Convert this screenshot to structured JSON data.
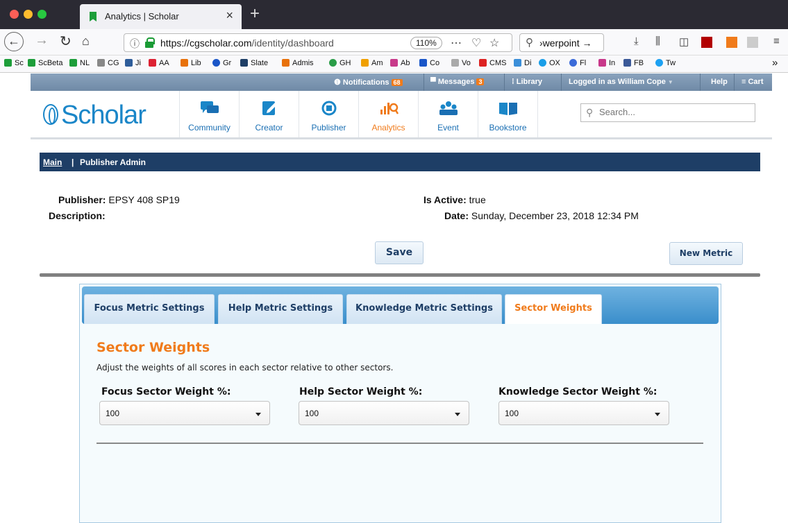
{
  "browser": {
    "tab_title": "Analytics | Scholar",
    "tab_close": "×",
    "new_tab": "+",
    "url_domain": "https://cgscholar.com",
    "url_path": "/identity/dashboard",
    "zoom": "110%",
    "search_text": "›werpoint →",
    "bookmarks": [
      "Sc",
      "ScBeta",
      "NL",
      "CG",
      "Ji",
      "AA",
      "Lib",
      "Gr",
      "Slate",
      "Admis",
      "GH",
      "Am",
      "Ab",
      "Co",
      "Vo",
      "CMS",
      "Di",
      "OX",
      "Fl",
      "In",
      "FB",
      "Tw"
    ],
    "overflow": "»"
  },
  "topstrip": {
    "notifications": "Notifications",
    "notifications_count": "68",
    "messages": "Messages",
    "messages_count": "3",
    "library": "Library",
    "logged_in": "Logged in as William Cope",
    "help": "Help",
    "cart": "Cart"
  },
  "header": {
    "logo": "Scholar",
    "nav": [
      "Community",
      "Creator",
      "Publisher",
      "Analytics",
      "Event",
      "Bookstore"
    ],
    "active_nav": "Analytics",
    "search_placeholder": "Search..."
  },
  "breadcrumb": {
    "main": "Main",
    "separator": "|",
    "current": "Publisher Admin"
  },
  "publisher": {
    "publisher_label": "Publisher:",
    "publisher_value": "EPSY 408 SP19",
    "description_label": "Description:",
    "is_active_label": "Is Active:",
    "is_active_value": "true",
    "date_label": "Date:",
    "date_value": "Sunday, December 23, 2018 12:34 PM"
  },
  "actions": {
    "save": "Save",
    "new_metric": "New Metric"
  },
  "tabs": [
    "Focus Metric Settings",
    "Help Metric Settings",
    "Knowledge Metric Settings",
    "Sector Weights"
  ],
  "active_tab": "Sector Weights",
  "sector_weights": {
    "title": "Sector Weights",
    "description": "Adjust the weights of all scores in each sector relative to other sectors.",
    "fields": [
      {
        "label": "Focus Sector Weight %:",
        "value": "100"
      },
      {
        "label": "Help Sector Weight %:",
        "value": "100"
      },
      {
        "label": "Knowledge Sector Weight %:",
        "value": "100"
      }
    ]
  },
  "colors": {
    "brand_blue": "#1a86c8",
    "accent_orange": "#f07b1b",
    "navy": "#1e3e66"
  }
}
